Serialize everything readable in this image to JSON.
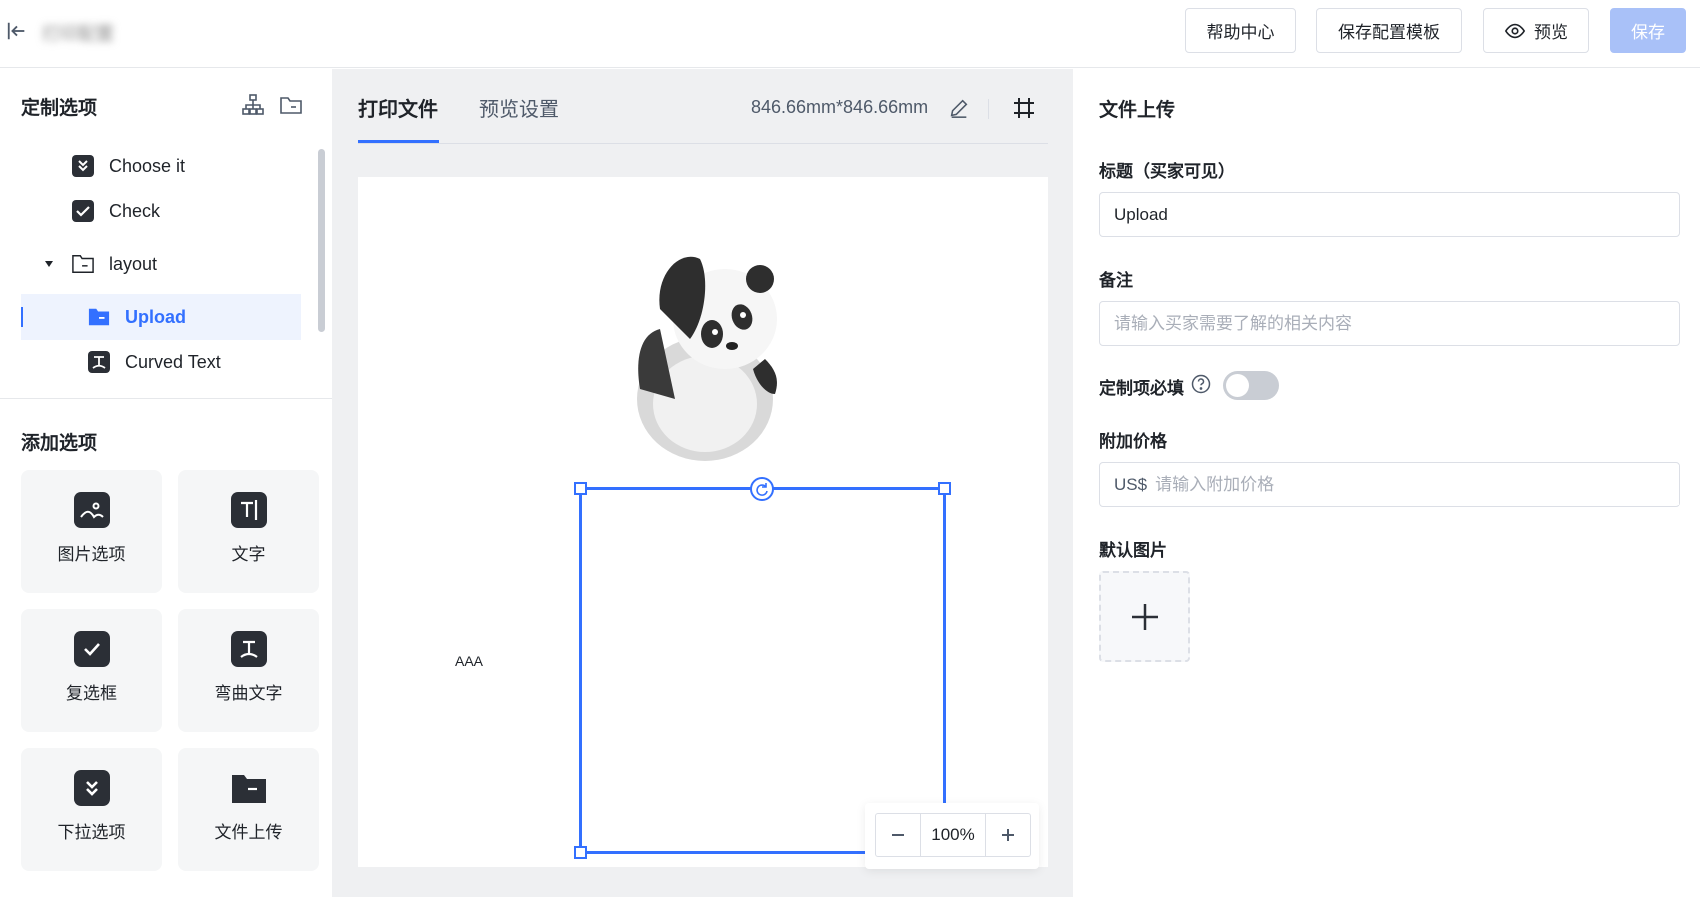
{
  "header": {
    "app_title": "打印配置",
    "help_label": "帮助中心",
    "save_template_label": "保存配置模板",
    "preview_label": "预览",
    "save_label": "保存"
  },
  "left_panel": {
    "title": "定制选项",
    "tree": [
      {
        "label": "Choose it",
        "icon": "dropdown-icon"
      },
      {
        "label": "Check",
        "icon": "checkbox-icon"
      },
      {
        "label": "layout",
        "icon": "folder-icon",
        "expanded": true
      },
      {
        "label": "Upload",
        "icon": "folder-upload-icon",
        "selected": true
      },
      {
        "label": "Curved Text",
        "icon": "curved-text-icon"
      }
    ],
    "add_title": "添加选项",
    "add_items": [
      {
        "label": "图片选项",
        "icon": "image-icon"
      },
      {
        "label": "文字",
        "icon": "text-icon"
      },
      {
        "label": "复选框",
        "icon": "checkbox-icon"
      },
      {
        "label": "弯曲文字",
        "icon": "curved-text-icon"
      },
      {
        "label": "下拉选项",
        "icon": "dropdown-icon"
      },
      {
        "label": "文件上传",
        "icon": "folder-icon"
      }
    ]
  },
  "center": {
    "tabs": [
      "打印文件",
      "预览设置"
    ],
    "active_tab": 0,
    "dimensions": "846.66mm*846.66mm",
    "canvas_text": "AAA",
    "zoom": "100%"
  },
  "right_panel": {
    "title": "文件上传",
    "title_label": "标题（买家可见）",
    "title_value": "Upload",
    "note_label": "备注",
    "note_placeholder": "请输入买家需要了解的相关内容",
    "required_label": "定制项必填",
    "required_on": false,
    "price_label": "附加价格",
    "price_prefix": "US$",
    "price_placeholder": "请输入附加价格",
    "default_image_label": "默认图片"
  },
  "colors": {
    "accent": "#3370ff",
    "save_disabled": "#a9c1f8"
  }
}
